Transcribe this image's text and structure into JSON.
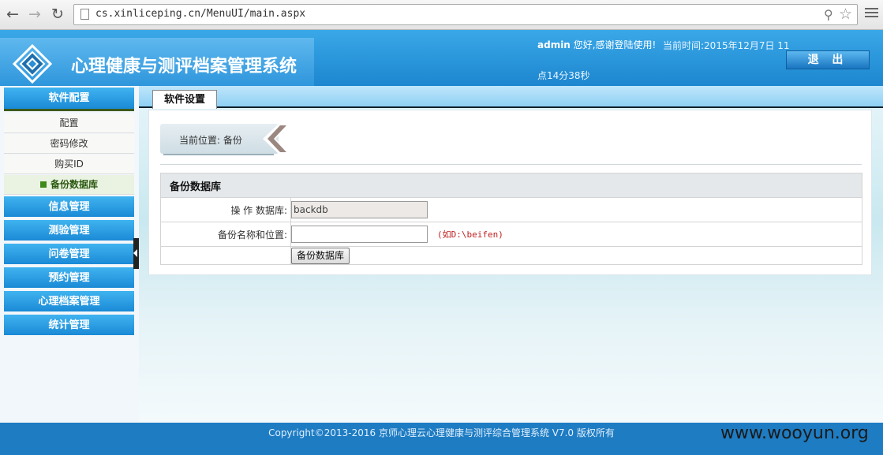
{
  "browser": {
    "url": "cs.xinliceping.cn/MenuUI/main.aspx"
  },
  "header": {
    "system_title": "心理健康与测评档案管理系统",
    "user": "admin",
    "greeting": "您好,感谢登陆使用!",
    "time_line1": "当前时间:2015年12月7日 11",
    "time_line2": "点14分38秒",
    "logout_label": "退 出"
  },
  "sidebar": {
    "groups": [
      {
        "label": "软件配置"
      },
      {
        "label": "信息管理"
      },
      {
        "label": "测验管理"
      },
      {
        "label": "问卷管理"
      },
      {
        "label": "预约管理"
      },
      {
        "label": "心理档案管理"
      },
      {
        "label": "统计管理"
      }
    ],
    "config_items": [
      {
        "label": "配置"
      },
      {
        "label": "密码修改"
      },
      {
        "label": "购买ID"
      },
      {
        "label": "备份数据库",
        "active": true
      }
    ]
  },
  "main": {
    "tab_label": "软件设置",
    "breadcrumb": "当前位置: 备份",
    "form": {
      "title": "备份数据库",
      "db_label": "操 作 数据库:",
      "db_value": "backdb",
      "path_label": "备份名称和位置:",
      "path_value": "",
      "path_hint": "(如D:\\beifen)",
      "submit_label": "备份数据库"
    }
  },
  "footer": {
    "copyright": "Copyright©2013-2016 京师心理云心理健康与测评综合管理系统 V7.0 版权所有",
    "watermark": "www.wooyun.org"
  },
  "colors": {
    "header_blue": "#1d86cf",
    "footer_blue": "#1e7cc2",
    "hint_red": "#c02020"
  }
}
